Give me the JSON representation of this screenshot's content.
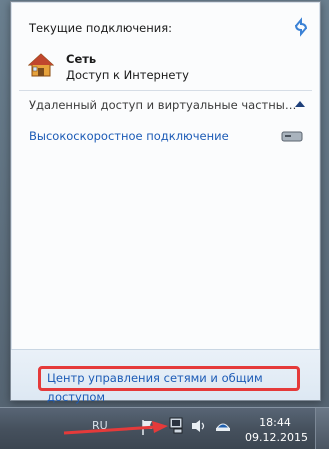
{
  "flyout": {
    "title": "Текущие подключения:",
    "current_network": {
      "name": "Сеть",
      "status": "Доступ к Интернету"
    },
    "section_title": "Удаленный доступ и виртуальные частные се...",
    "connections": [
      {
        "label": "Высокоскоростное подключение"
      }
    ],
    "footer_link": "Центр управления сетями и общим доступом"
  },
  "taskbar": {
    "language": "RU",
    "time": "18:44",
    "date": "09.12.2015"
  },
  "colors": {
    "highlight": "#e53a3a",
    "link": "#1c5bb6"
  }
}
